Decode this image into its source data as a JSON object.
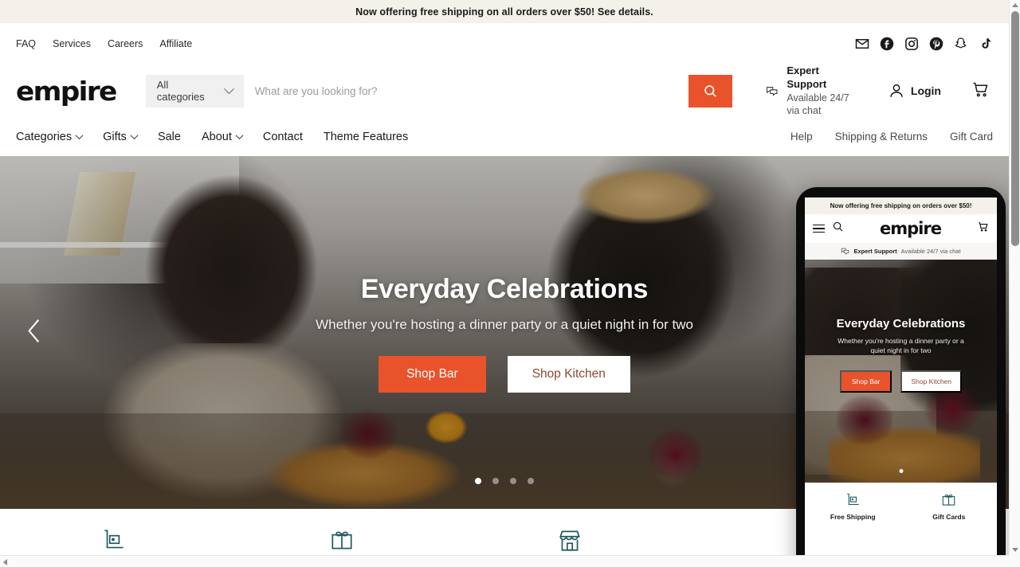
{
  "announcement": {
    "text": "Now offering free shipping on all orders over $50! See details."
  },
  "utility_bar": {
    "links": [
      {
        "label": "FAQ"
      },
      {
        "label": "Services"
      },
      {
        "label": "Careers"
      },
      {
        "label": "Affiliate"
      }
    ],
    "socials": [
      {
        "name": "email-icon"
      },
      {
        "name": "facebook-icon"
      },
      {
        "name": "instagram-icon"
      },
      {
        "name": "pinterest-icon"
      },
      {
        "name": "snapchat-icon"
      },
      {
        "name": "tiktok-icon"
      }
    ]
  },
  "header": {
    "logo": "empire",
    "search": {
      "category_label": "All categories",
      "placeholder": "What are you looking for?",
      "value": "",
      "button_icon": "search-icon"
    },
    "support": {
      "title": "Expert Support",
      "subtitle": "Available 24/7 via chat"
    },
    "login_label": "Login",
    "cart_icon": "cart-icon"
  },
  "nav": {
    "primary": [
      {
        "label": "Categories",
        "has_dropdown": true
      },
      {
        "label": "Gifts",
        "has_dropdown": true
      },
      {
        "label": "Sale",
        "has_dropdown": false
      },
      {
        "label": "About",
        "has_dropdown": true
      },
      {
        "label": "Contact",
        "has_dropdown": false
      },
      {
        "label": "Theme Features",
        "has_dropdown": false
      }
    ],
    "secondary": [
      {
        "label": "Help"
      },
      {
        "label": "Shipping & Returns"
      },
      {
        "label": "Gift Card"
      }
    ]
  },
  "hero": {
    "title": "Everyday Celebrations",
    "subtitle": "Whether you're hosting a dinner party or a quiet night in for two",
    "primary_button": "Shop Bar",
    "secondary_button": "Shop Kitchen",
    "slide_count": 4,
    "active_slide": 1,
    "prev_icon": "chevron-left-icon"
  },
  "features": [
    {
      "label": "",
      "icon": "shipping-cart-icon"
    },
    {
      "label": "",
      "icon": "gift-box-icon"
    },
    {
      "label": "",
      "icon": "storefront-icon"
    }
  ],
  "phone_preview": {
    "announcement": "Now offering free shipping on orders over $50!",
    "logo": "empire",
    "support": {
      "title": "Expert Support",
      "subtitle": "Available 24/7 via chat"
    },
    "hero": {
      "title": "Everyday Celebrations",
      "subtitle": "Whether you're hosting a dinner party or a quiet night in for two",
      "primary_button": "Shop Bar",
      "secondary_button": "Shop Kitchen"
    },
    "features": [
      {
        "label": "Free Shipping",
        "icon": "shipping-cart-icon"
      },
      {
        "label": "Gift Cards",
        "icon": "gift-box-icon"
      }
    ]
  },
  "colors": {
    "accent": "#e8532c",
    "announcement_bg": "#f4f1ea",
    "feature_icon": "#1f5a5f",
    "secondary_button_text": "#8d4a34"
  }
}
